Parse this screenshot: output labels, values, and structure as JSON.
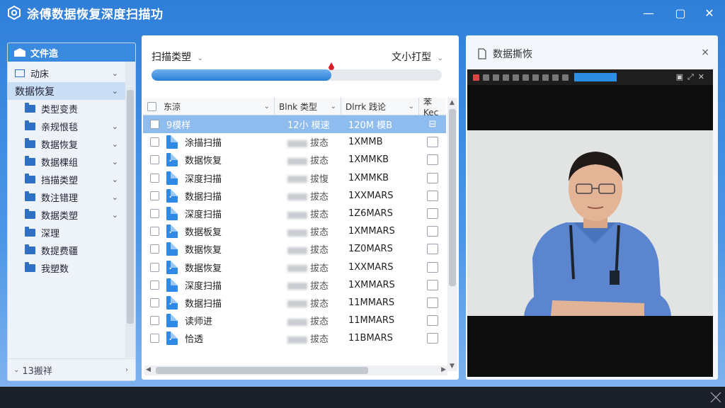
{
  "window": {
    "title": "涂傅数据恢复深度扫描功",
    "minimize_label": "—",
    "maximize_label": "▢",
    "close_label": "✕"
  },
  "sidebar": {
    "header": "文件造",
    "items": [
      {
        "label": "动床",
        "chevron": true,
        "top": true
      },
      {
        "label": "数据恢复",
        "chevron": true,
        "selected": true
      },
      {
        "label": "类型变责",
        "chevron": false
      },
      {
        "label": "亲规恨毯",
        "chevron": true
      },
      {
        "label": "数据恢复",
        "chevron": true
      },
      {
        "label": "数据棵组",
        "chevron": true
      },
      {
        "label": "挡描类塑",
        "chevron": true
      },
      {
        "label": "数注错理",
        "chevron": true
      },
      {
        "label": "数据类塑",
        "chevron": true
      },
      {
        "label": "深理",
        "chevron": false
      },
      {
        "label": "数提费疆",
        "chevron": false
      },
      {
        "label": "我塑数",
        "chevron": false
      }
    ],
    "footer": "13搬祥"
  },
  "center": {
    "scan_type_label": "扫描类塑",
    "format_label": "文小打型",
    "progress_percent": 62,
    "columns": [
      "东涼",
      "Blnk 类型",
      "Dlrrk 践论",
      "苯Kec"
    ],
    "rows": [
      {
        "name": "9模样",
        "type": "12小 模速",
        "size": "120M 模B",
        "selected": true
      },
      {
        "name": "涂描扫描",
        "type": "拔态",
        "size": "1XMMB"
      },
      {
        "name": "数据恢复",
        "type": "拔态",
        "size": "1XMMKB"
      },
      {
        "name": "深度扫描",
        "type": "拔愎",
        "size": "1XMMKB"
      },
      {
        "name": "数据扫描",
        "type": "拔态",
        "size": "1XXMARS"
      },
      {
        "name": "深度扫描",
        "type": "拔态",
        "size": "1Z6MARS"
      },
      {
        "name": "数据板复",
        "type": "拔态",
        "size": "1XMMARS"
      },
      {
        "name": "数据恢复",
        "type": "拔态",
        "size": "1Z0MARS"
      },
      {
        "name": "数据恢复",
        "type": "拔态",
        "size": "1XXMARS"
      },
      {
        "name": "深度扫描",
        "type": "拔态",
        "size": "1XMMARS"
      },
      {
        "name": "数据扫描",
        "type": "拔态",
        "size": "11MMARS"
      },
      {
        "name": "读师进",
        "type": "拔态",
        "size": "11MMARS"
      },
      {
        "name": "恰透",
        "type": "拔态",
        "size": "11BMARS"
      }
    ]
  },
  "preview": {
    "title": "数据撕恢",
    "close_label": "×"
  }
}
